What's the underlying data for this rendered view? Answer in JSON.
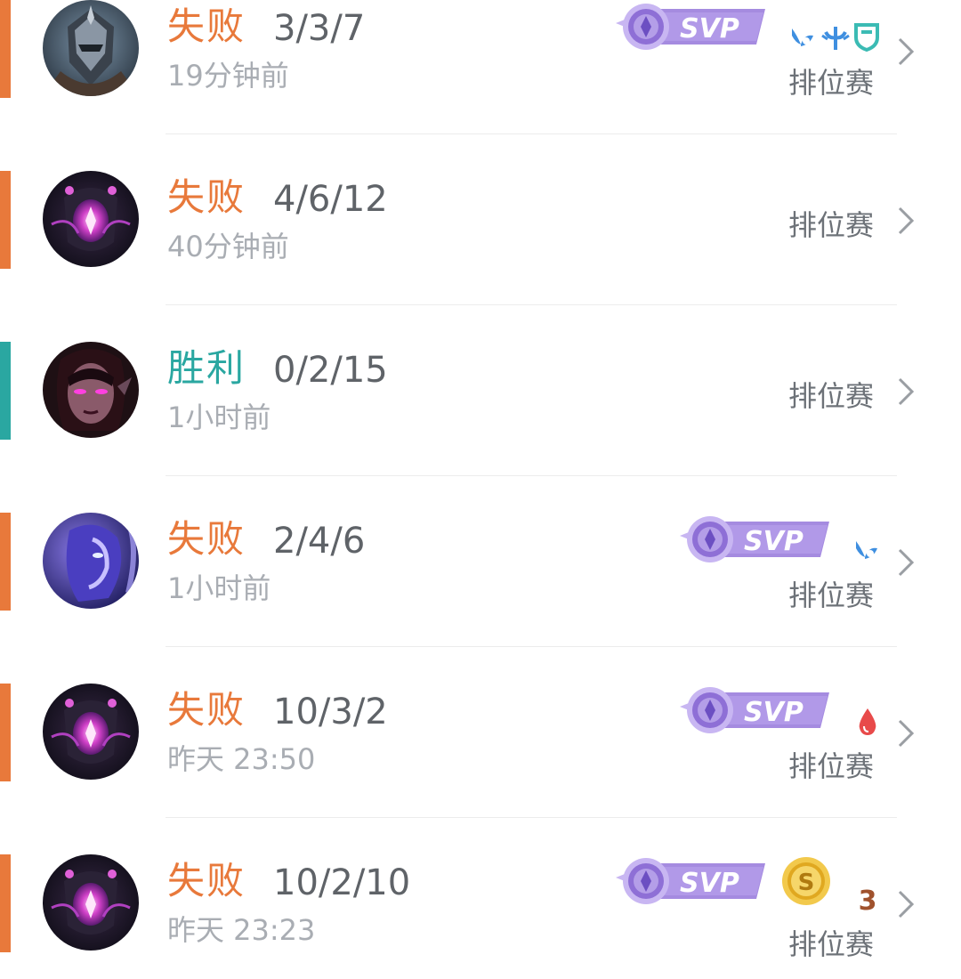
{
  "matches": [
    {
      "result": "失败",
      "result_type": "loss",
      "kda": "3/3/7",
      "time": "19分钟前",
      "mode": "排位赛",
      "svp_label": "SVP",
      "hero_avatar": "hero-portrait-armored-knight",
      "extra_icons": [
        "wings-icon",
        "trident-icon",
        "shield-icon"
      ]
    },
    {
      "result": "失败",
      "result_type": "loss",
      "kda": "4/6/12",
      "time": "40分钟前",
      "mode": "排位赛",
      "hero_avatar": "hero-portrait-void-crystal"
    },
    {
      "result": "胜利",
      "result_type": "win",
      "kda": "0/2/15",
      "time": "1小时前",
      "mode": "排位赛",
      "hero_avatar": "hero-portrait-dark-sorceress"
    },
    {
      "result": "失败",
      "result_type": "loss",
      "kda": "2/4/6",
      "time": "1小时前",
      "mode": "排位赛",
      "svp_label": "SVP",
      "hero_avatar": "hero-portrait-blue-spirit",
      "extra_icons": [
        "wings-icon"
      ]
    },
    {
      "result": "失败",
      "result_type": "loss",
      "kda": "10/3/2",
      "time": "昨天 23:50",
      "mode": "排位赛",
      "svp_label": "SVP",
      "hero_avatar": "hero-portrait-void-crystal",
      "extra_icons": [
        "blood-drop-icon"
      ]
    },
    {
      "result": "失败",
      "result_type": "loss",
      "kda": "10/2/10",
      "time": "昨天 23:23",
      "mode": "排位赛",
      "svp_label": "SVP",
      "coin_label": "S",
      "multikill_label": "3",
      "hero_avatar": "hero-portrait-void-crystal",
      "extra_icons": [
        "gold-coin-icon",
        "triple-kill-icon"
      ]
    }
  ],
  "colors": {
    "loss": "#e8793b",
    "win": "#2aa7a1",
    "kda": "#5f6368",
    "time": "#a9adb3",
    "mode": "#6d7278",
    "svp_purple": "#9b7fd9",
    "icon_blue": "#3f8fe0",
    "icon_teal": "#3bbbb4",
    "blood_red": "#e84a4a"
  }
}
